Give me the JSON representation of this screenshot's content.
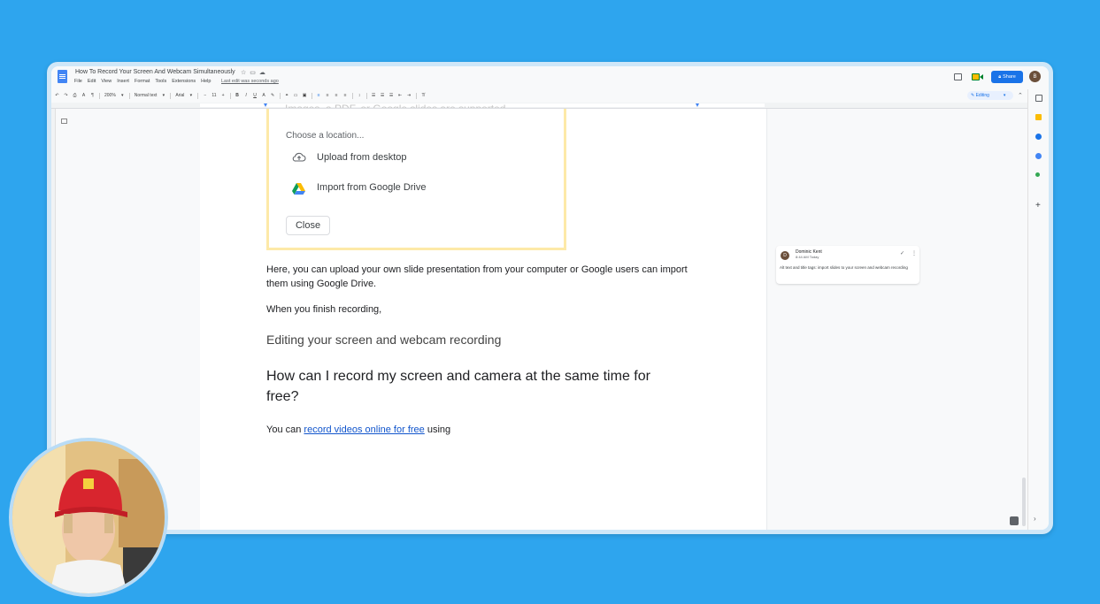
{
  "window": {
    "doc_title": "How To Record Your Screen And Webcam Simultaneously",
    "menu": [
      "File",
      "Edit",
      "View",
      "Insert",
      "Format",
      "Tools",
      "Extensions",
      "Help"
    ],
    "last_edit": "Last edit was seconds ago",
    "share_label": "Share",
    "user_initial": "B"
  },
  "toolbar": {
    "zoom": "200%",
    "style": "Normal text",
    "font": "Arial",
    "font_size": "11",
    "mode": "Editing"
  },
  "dialog": {
    "cut_text": "Images, a PDF, or Google slides are supported.",
    "prompt": "Choose a location...",
    "option_upload": "Upload from desktop",
    "option_drive": "Import from Google Drive",
    "close_label": "Close"
  },
  "doc": {
    "paragraph1": "Here, you can upload your own slide presentation from your computer or Google users can import them using Google Drive.",
    "paragraph2": "When you finish recording,",
    "heading3": "Editing your screen and webcam recording",
    "heading2": "How can I record my screen and camera at the same time for free?",
    "paragraph3_prefix": "You can ",
    "paragraph3_link": "record videos online for free",
    "paragraph3_suffix": " using"
  },
  "comment": {
    "author_initial": "D",
    "author": "Dominic Kent",
    "time": "8:44 AM Today",
    "text": "Alt text and title tags: import slides to your screen and webcam recording"
  },
  "colors": {
    "background": "#2ea5ee",
    "share": "#1a73e8",
    "link": "#1155cc"
  }
}
